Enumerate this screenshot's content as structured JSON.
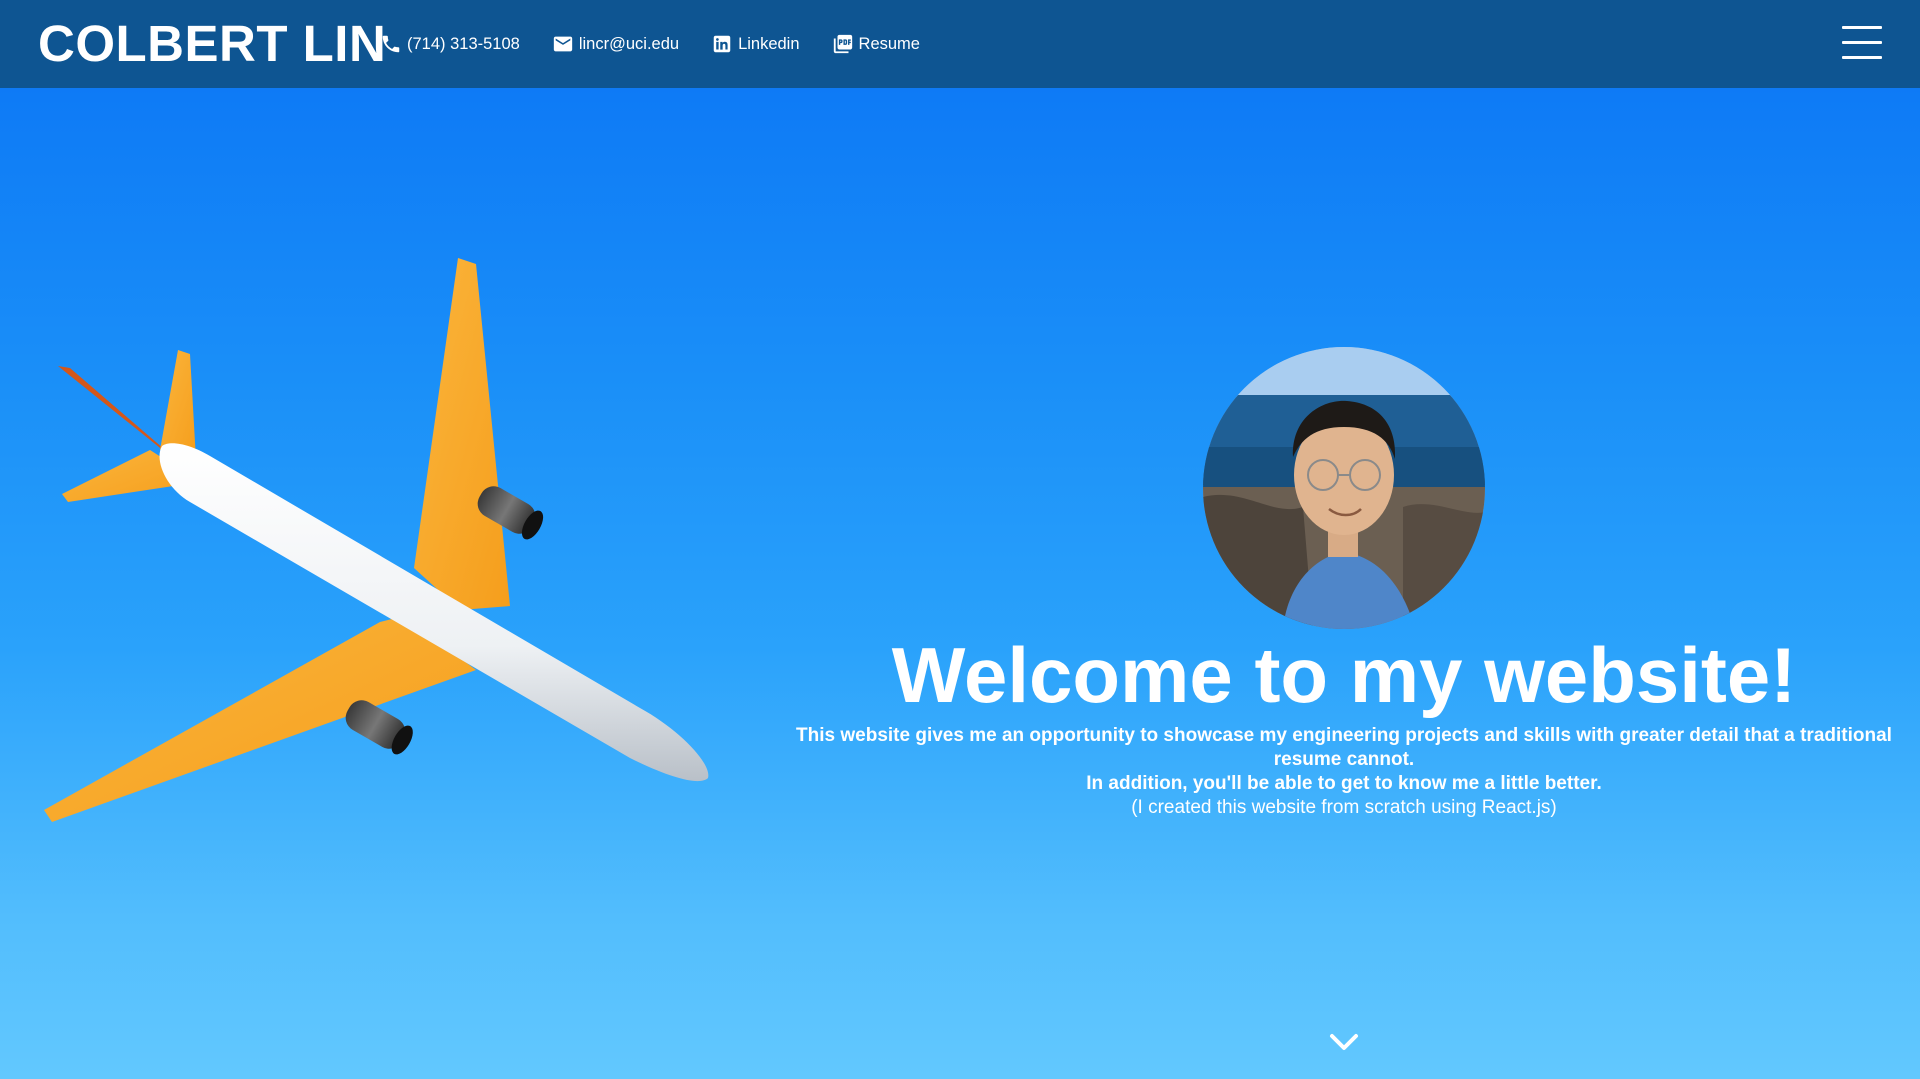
{
  "navbar": {
    "brand": "COLBERT LIN",
    "links": [
      {
        "label": "(714) 313-5108",
        "icon": "phone-icon"
      },
      {
        "label": "lincr@uci.edu",
        "icon": "mail-icon"
      },
      {
        "label": "Linkedin",
        "icon": "linkedin-icon"
      },
      {
        "label": "Resume",
        "icon": "pdf-icon"
      }
    ],
    "menu_icon": "hamburger-menu-icon"
  },
  "hero": {
    "headline": "Welcome to my website!",
    "tagline_1": "This website gives me an opportunity to showcase my engineering projects and skills with greater detail that a traditional resume cannot.",
    "tagline_2": "In addition, you'll be able to get to know me a little better.",
    "note": "(I created this website from scratch using React.js)",
    "scroll_icon": "chevron-down-icon"
  },
  "colors": {
    "navbar_bg": "#0e5592",
    "sky_top": "#0a74f5",
    "sky_bottom": "#62c8fe",
    "wing_accent": "#fbad2c"
  }
}
